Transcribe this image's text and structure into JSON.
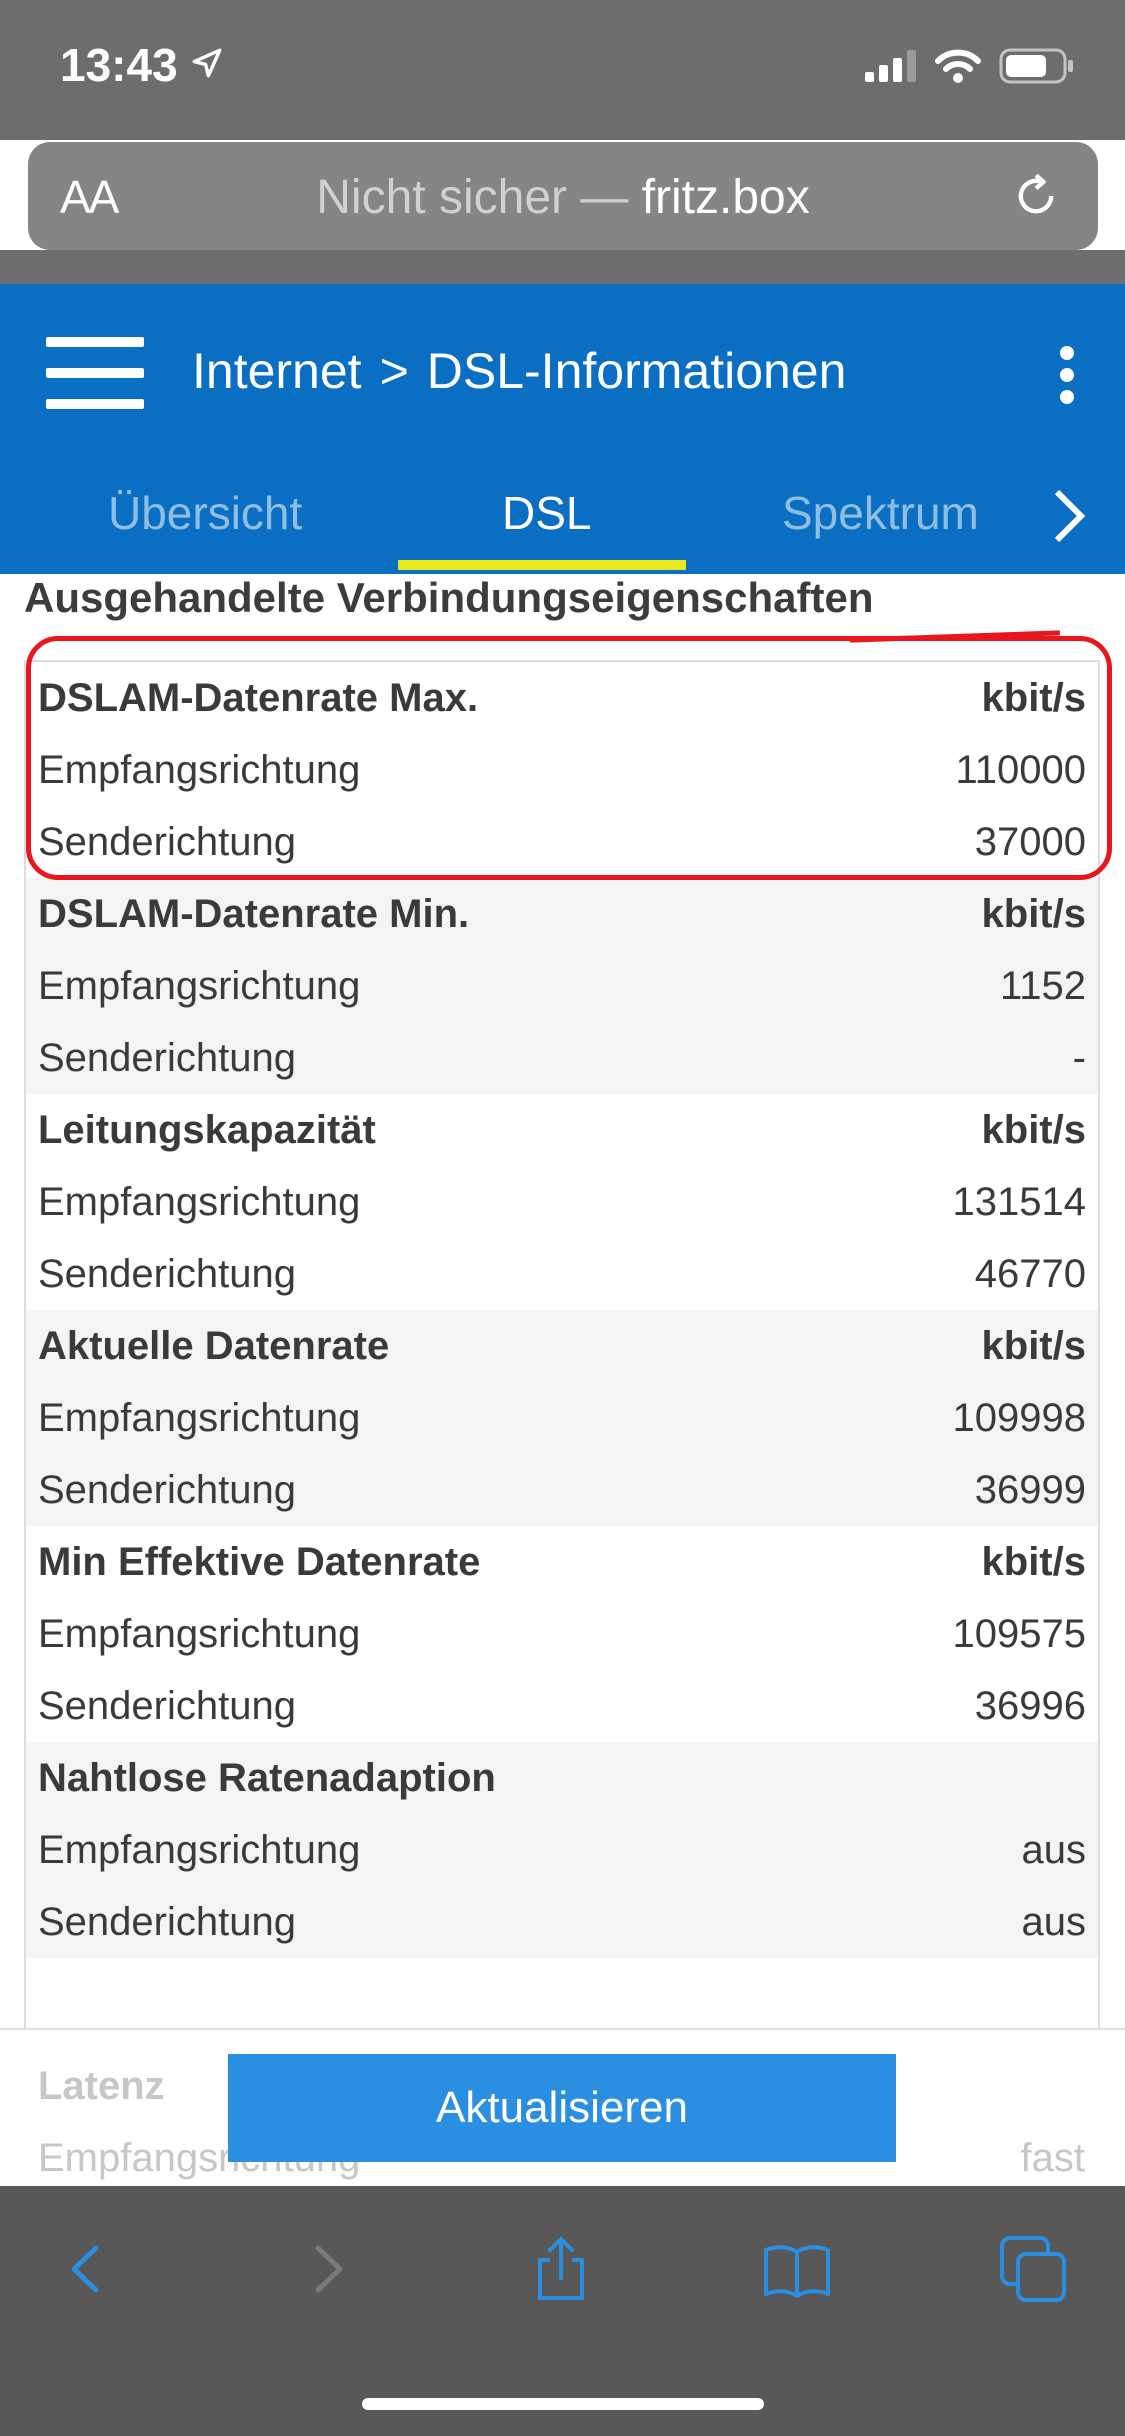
{
  "status_bar": {
    "time": "13:43",
    "icons": [
      "location-arrow-icon",
      "signal-icon",
      "wifi-icon",
      "battery-icon"
    ]
  },
  "url_bar": {
    "aa_label": "AA",
    "security_text": "Nicht sicher —",
    "host": "fritz.box"
  },
  "header": {
    "breadcrumb_section": "Internet",
    "breadcrumb_separator": ">",
    "breadcrumb_page": "DSL-Informationen",
    "tabs": [
      {
        "label": "Übersicht",
        "active": false
      },
      {
        "label": "DSL",
        "active": true
      },
      {
        "label": "Spektrum",
        "active": false
      }
    ],
    "accent_color": "#0a6fc2",
    "tab_indicator_color": "#e8ea1c"
  },
  "section": {
    "title": "Ausgehandelte Verbindungseigenschaften"
  },
  "table": {
    "groups": [
      {
        "heading": "DSLAM-Datenrate Max.",
        "unit": "kbit/s",
        "rows": [
          {
            "label": "Empfangsrichtung",
            "value": "110000"
          },
          {
            "label": "Senderichtung",
            "value": "37000"
          }
        ]
      },
      {
        "heading": "DSLAM-Datenrate Min.",
        "unit": "kbit/s",
        "rows": [
          {
            "label": "Empfangsrichtung",
            "value": "1152"
          },
          {
            "label": "Senderichtung",
            "value": "-"
          }
        ]
      },
      {
        "heading": "Leitungskapazität",
        "unit": "kbit/s",
        "rows": [
          {
            "label": "Empfangsrichtung",
            "value": "131514"
          },
          {
            "label": "Senderichtung",
            "value": "46770"
          }
        ]
      },
      {
        "heading": "Aktuelle Datenrate",
        "unit": "kbit/s",
        "rows": [
          {
            "label": "Empfangsrichtung",
            "value": "109998"
          },
          {
            "label": "Senderichtung",
            "value": "36999"
          }
        ]
      },
      {
        "heading": "Min Effektive Datenrate",
        "unit": "kbit/s",
        "rows": [
          {
            "label": "Empfangsrichtung",
            "value": "109575"
          },
          {
            "label": "Senderichtung",
            "value": "36996"
          }
        ]
      },
      {
        "heading": "Nahtlose Ratenadaption",
        "unit": "",
        "rows": [
          {
            "label": "Empfangsrichtung",
            "value": "aus"
          },
          {
            "label": "Senderichtung",
            "value": "aus"
          }
        ]
      }
    ],
    "partial_group": {
      "heading": "Latenz",
      "first_row_label": "Empfangsrichtung",
      "first_row_value": "fast"
    }
  },
  "annotation": {
    "color": "#e8161d",
    "description_of_target": "DSLAM-Datenrate Max."
  },
  "actions": {
    "update_label": "Aktualisieren"
  },
  "toolbar": {
    "icons": [
      "back-icon",
      "forward-icon",
      "share-icon",
      "bookmarks-icon",
      "tabs-icon"
    ]
  }
}
